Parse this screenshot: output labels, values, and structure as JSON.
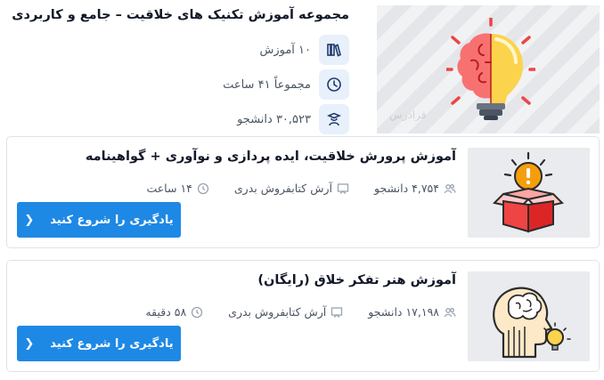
{
  "collection": {
    "title": "مجموعه آموزش تکنیک های خلاقیت – جامع و کاربردی",
    "courses_count": "۱۰ آموزش",
    "total_hours": "مجموعاً ۴۱ ساعت",
    "students": "۳۰,۵۲۳ دانشجو",
    "watermark": "فرادرس"
  },
  "courses": [
    {
      "title": "آموزش پرورش خلاقیت، ایده پردازی و نوآوری + گواهینامه",
      "students": "۴,۷۵۴ دانشجو",
      "instructor": "آرش کتابفروش بدری",
      "duration": "۱۴ ساعت",
      "cta_label": "یادگیری را شروع کنید"
    },
    {
      "title": "آموزش هنر تفکر خلاق (رایگان)",
      "students": "۱۷,۱۹۸ دانشجو",
      "instructor": "آرش کتابفروش بدری",
      "duration": "۵۸ دقیقه",
      "cta_label": "یادگیری را شروع کنید"
    }
  ],
  "colors": {
    "primary_button": "#1e88e5",
    "icon_chip_bg": "#e8f0fb",
    "thumb_bg": "#e9ebee"
  },
  "icons": {
    "courses": "books-icon",
    "hours": "clock-icon",
    "students": "graduate-icon",
    "card_students": "users-icon",
    "card_instructor": "presentation-icon",
    "card_duration": "clock-icon",
    "cta": "chevron-left-icon"
  }
}
